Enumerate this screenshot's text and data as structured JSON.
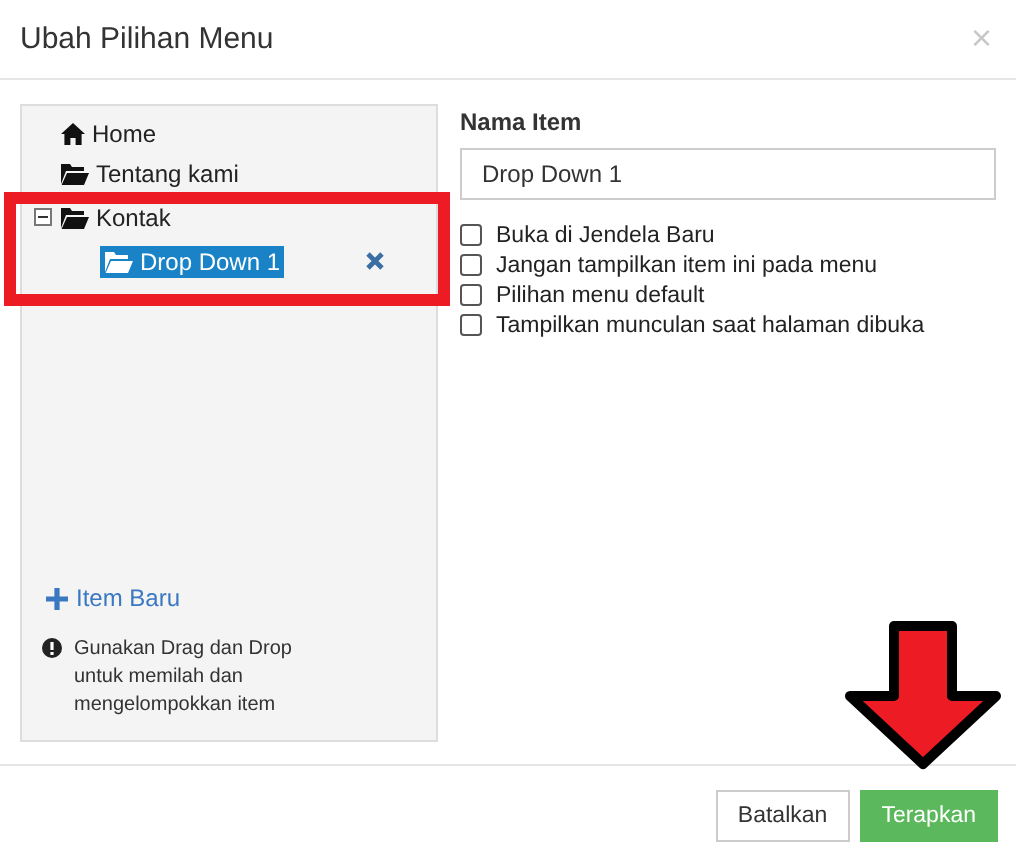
{
  "dialog": {
    "title": "Ubah Pilihan Menu",
    "close": "×"
  },
  "tree": [
    {
      "label": "Home",
      "kind": "home",
      "selected": false
    },
    {
      "label": "Tentang kami",
      "kind": "folder",
      "selected": false
    },
    {
      "label": "Kontak",
      "kind": "folder",
      "selected": false,
      "expanded": true,
      "children": [
        {
          "label": "Drop Down 1",
          "kind": "folder",
          "selected": true
        }
      ]
    }
  ],
  "add_item": {
    "label": "Item Baru"
  },
  "hint": "Gunakan Drag dan Drop untuk memilah dan mengelompokkan item",
  "form": {
    "label": "Nama Item",
    "value": "Drop Down 1",
    "options": [
      {
        "label": "Buka di Jendela Baru",
        "checked": false
      },
      {
        "label": "Jangan tampilkan item ini pada menu",
        "checked": false
      },
      {
        "label": "Pilihan menu default",
        "checked": false
      },
      {
        "label": "Tampilkan munculan saat halaman dibuka",
        "checked": false
      }
    ]
  },
  "buttons": [
    {
      "label": "Batalkan",
      "kind": "default"
    },
    {
      "label": "Terapkan",
      "kind": "primary"
    }
  ],
  "annotations": {
    "highlight_box": true,
    "arrow": true
  }
}
